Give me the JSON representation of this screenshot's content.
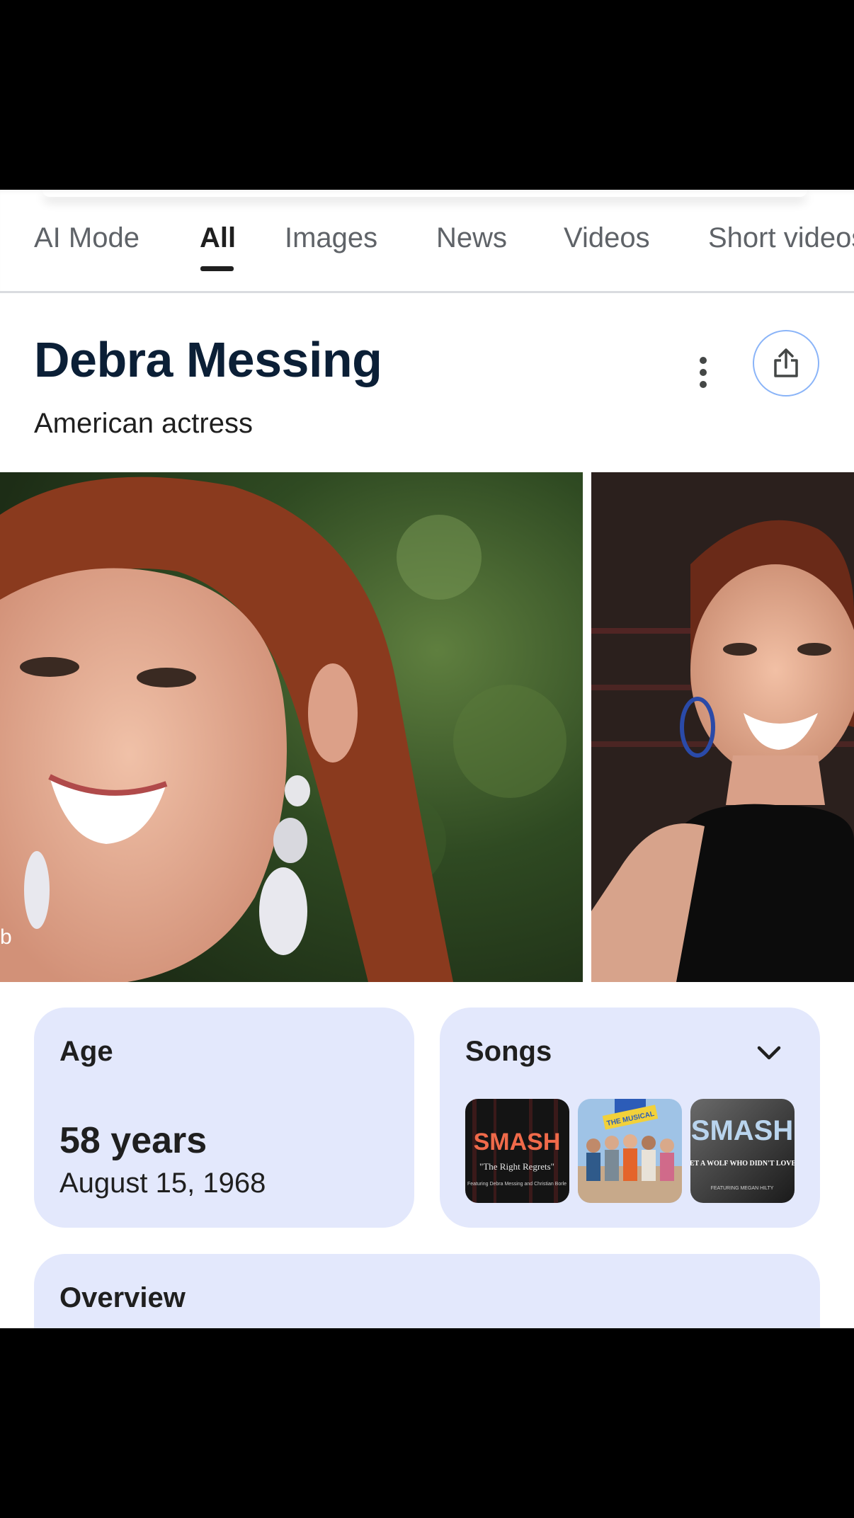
{
  "tabs": [
    {
      "label": "AI Mode",
      "active": false
    },
    {
      "label": "All",
      "active": true
    },
    {
      "label": "Images",
      "active": false
    },
    {
      "label": "News",
      "active": false
    },
    {
      "label": "Videos",
      "active": false
    },
    {
      "label": "Short videos",
      "active": false
    }
  ],
  "entity": {
    "title": "Debra Messing",
    "subtitle": "American actress"
  },
  "images": {
    "photo1_credit": "b"
  },
  "age_card": {
    "label": "Age",
    "value": "58 years",
    "date": "August 15, 1968"
  },
  "songs_card": {
    "label": "Songs",
    "thumbs": [
      {
        "brand": "SMASH",
        "caption": "\"The Right Regrets\"",
        "small": "Featuring Debra Messing and Christian Borle"
      },
      {
        "brand": "THE MUSICAL"
      },
      {
        "brand": "SMASH",
        "caption": "\"I NEVER MET A WOLF WHO DIDN'T LOVE TO HOWL\"",
        "small": "FEATURING MEGAN HILTY"
      }
    ]
  },
  "overview_card": {
    "label": "Overview"
  },
  "colors": {
    "card_bg": "#e3e8fc",
    "title": "#0b1f36",
    "share_border": "#8ab4f8"
  }
}
